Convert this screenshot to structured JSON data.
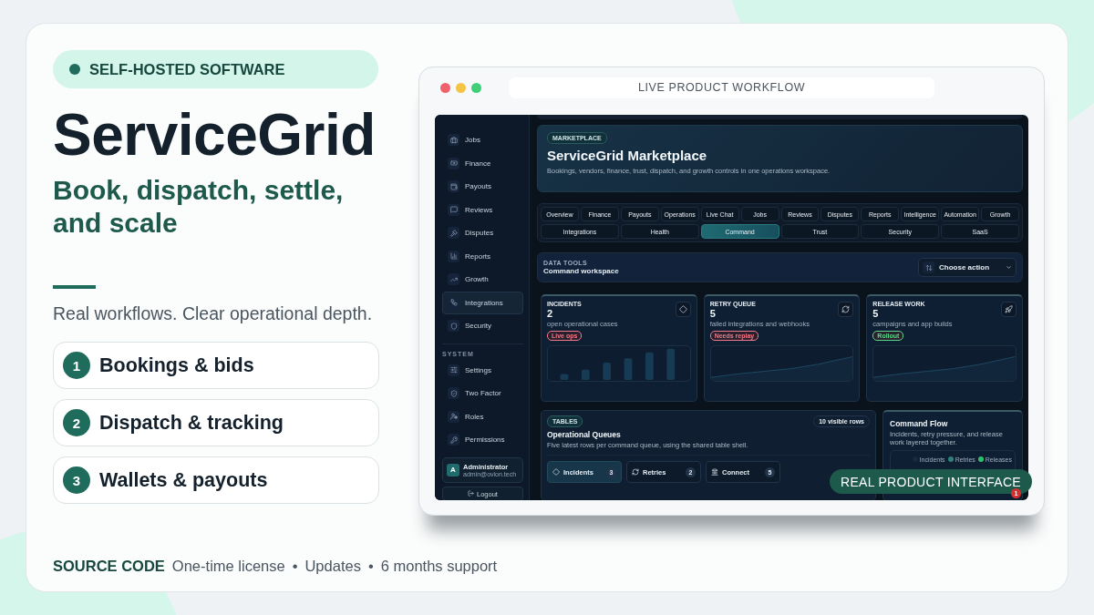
{
  "hero": {
    "badge": "SELF-HOSTED SOFTWARE",
    "title": "ServiceGrid",
    "subtitle": "Book, dispatch, settle, and scale",
    "tagline": "Real workflows. Clear operational depth."
  },
  "features": [
    {
      "number": "1",
      "label": "Bookings & bids"
    },
    {
      "number": "2",
      "label": "Dispatch & tracking"
    },
    {
      "number": "3",
      "label": "Wallets & payouts"
    }
  ],
  "footer": {
    "label": "SOURCE CODE",
    "separator": "•",
    "items": [
      "One-time license",
      "Updates",
      "6 months support"
    ]
  },
  "browser": {
    "address": "LIVE PRODUCT WORKFLOW",
    "overlay_badge": "REAL PRODUCT INTERFACE"
  },
  "app": {
    "sidebar": {
      "items": [
        {
          "label": "Jobs",
          "selected": false
        },
        {
          "label": "Finance",
          "selected": false
        },
        {
          "label": "Payouts",
          "selected": false
        },
        {
          "label": "Reviews",
          "selected": false
        },
        {
          "label": "Disputes",
          "selected": false
        },
        {
          "label": "Reports",
          "selected": false
        },
        {
          "label": "Growth",
          "selected": false
        },
        {
          "label": "Integrations",
          "selected": true
        },
        {
          "label": "Security",
          "selected": false
        }
      ],
      "section": "SYSTEM",
      "system_items": [
        {
          "label": "Settings",
          "selected": false
        },
        {
          "label": "Two Factor",
          "selected": false
        },
        {
          "label": "Roles",
          "selected": false
        },
        {
          "label": "Permissions",
          "selected": false
        }
      ],
      "user": {
        "avatar": "A",
        "name": "Administrator",
        "email": "admin@ovion.tech"
      },
      "logout": "Logout"
    },
    "header": {
      "badge": "MARKETPLACE",
      "title": "ServiceGrid Marketplace",
      "subtitle": "Bookings, vendors, finance, trust, dispatch, and growth controls in one operations workspace."
    },
    "tabs": [
      [
        {
          "label": "Overview",
          "selected": false
        },
        {
          "label": "Finance",
          "selected": false
        },
        {
          "label": "Payouts",
          "selected": false
        },
        {
          "label": "Operations",
          "selected": false
        },
        {
          "label": "Live Chat",
          "selected": false
        },
        {
          "label": "Jobs",
          "selected": false
        },
        {
          "label": "Reviews",
          "selected": false
        },
        {
          "label": "Disputes",
          "selected": false
        },
        {
          "label": "Reports",
          "selected": false
        },
        {
          "label": "Intelligence",
          "selected": false
        },
        {
          "label": "Automation",
          "selected": false
        },
        {
          "label": "Growth",
          "selected": false
        }
      ],
      [
        {
          "label": "Integrations",
          "selected": false
        },
        {
          "label": "Health",
          "selected": false
        },
        {
          "label": "Command",
          "selected": true
        },
        {
          "label": "Trust",
          "selected": false
        },
        {
          "label": "Security",
          "selected": false
        },
        {
          "label": "SaaS",
          "selected": false
        }
      ]
    ],
    "data_tools": {
      "eyebrow": "DATA TOOLS",
      "title": "Command workspace",
      "action": "Choose action"
    },
    "stats": [
      {
        "label": "INCIDENTS",
        "value": "2",
        "description": "open operational cases",
        "tag": "Live ops",
        "color": "#f07a8a",
        "kind": "bars"
      },
      {
        "label": "RETRY QUEUE",
        "value": "5",
        "description": "failed integrations and webhooks",
        "tag": "Needs replay",
        "color": "#f07a8a",
        "kind": "line"
      },
      {
        "label": "RELEASE WORK",
        "value": "5",
        "description": "campaigns and app builds",
        "tag": "Rollout",
        "color": "#5fd68f",
        "kind": "line"
      }
    ],
    "tables": {
      "badge": "TABLES",
      "count": "10 visible rows",
      "title": "Operational Queues",
      "description": "Five latest rows per command queue, using the shared table shell.",
      "queues": [
        {
          "label": "Incidents",
          "count": "3",
          "selected": true
        },
        {
          "label": "Retries",
          "count": "2",
          "selected": false
        },
        {
          "label": "Connect",
          "count": "5",
          "selected": false
        }
      ]
    },
    "flow": {
      "title": "Command Flow",
      "description": "Incidents, retry pressure, and release work layered together.",
      "legend": [
        {
          "label": "Incidents",
          "color": "#1b2a3a"
        },
        {
          "label": "Retries",
          "color": "#2f7f7a"
        },
        {
          "label": "Releases",
          "color": "#2fbf6a"
        }
      ]
    },
    "notification": {
      "count": "1"
    }
  }
}
